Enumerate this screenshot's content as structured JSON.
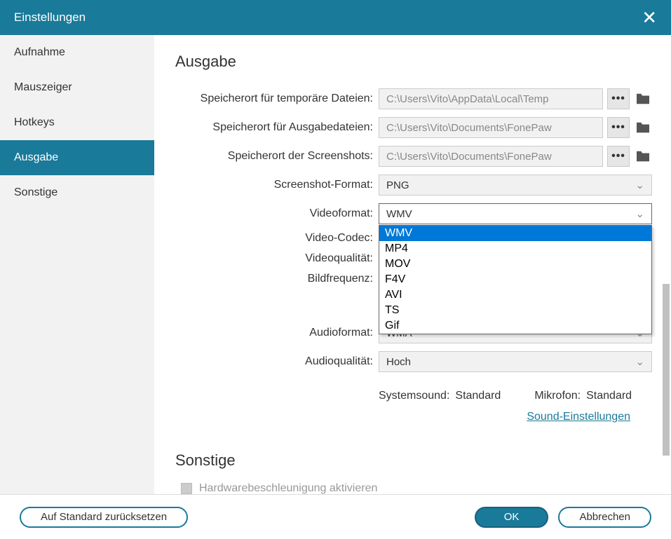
{
  "window": {
    "title": "Einstellungen"
  },
  "sidebar": {
    "items": [
      {
        "label": "Aufnahme"
      },
      {
        "label": "Mauszeiger"
      },
      {
        "label": "Hotkeys"
      },
      {
        "label": "Ausgabe"
      },
      {
        "label": "Sonstige"
      }
    ],
    "active_index": 3
  },
  "sections": {
    "output": {
      "heading": "Ausgabe"
    },
    "other": {
      "heading": "Sonstige"
    }
  },
  "fields": {
    "temp_path": {
      "label": "Speicherort für temporäre Dateien:",
      "value": "C:\\Users\\Vito\\AppData\\Local\\Temp"
    },
    "output_path": {
      "label": "Speicherort für Ausgabedateien:",
      "value": "C:\\Users\\Vito\\Documents\\FonePaw"
    },
    "screenshot_path": {
      "label": "Speicherort der Screenshots:",
      "value": "C:\\Users\\Vito\\Documents\\FonePaw"
    },
    "screenshot_format": {
      "label": "Screenshot-Format:",
      "value": "PNG"
    },
    "video_format": {
      "label": "Videoformat:",
      "value": "WMV",
      "options": [
        "WMV",
        "MP4",
        "MOV",
        "F4V",
        "AVI",
        "TS",
        "Gif"
      ],
      "selected_index": 0
    },
    "video_codec": {
      "label": "Video-Codec:"
    },
    "video_quality": {
      "label": "Videoqualität:"
    },
    "framerate": {
      "label": "Bildfrequenz:"
    },
    "audio_format": {
      "label": "Audioformat:",
      "value": "WMA"
    },
    "audio_quality": {
      "label": "Audioqualität:",
      "value": "Hoch"
    }
  },
  "audio_info": {
    "system_label": "Systemsound:",
    "system_value": "Standard",
    "mic_label": "Mikrofon:",
    "mic_value": "Standard"
  },
  "links": {
    "sound_settings": "Sound-Einstellungen"
  },
  "checkboxes": {
    "hw_accel": "Hardwarebeschleunigung aktivieren"
  },
  "footer": {
    "reset": "Auf Standard zurücksetzen",
    "ok": "OK",
    "cancel": "Abbrechen"
  }
}
